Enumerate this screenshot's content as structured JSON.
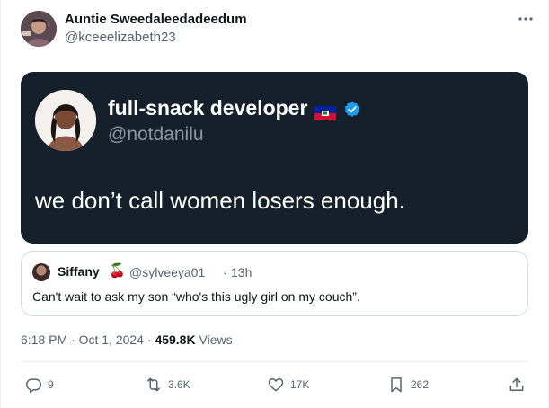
{
  "author": {
    "name": "Auntie Sweedaleedadeedum",
    "handle": "@kceeelizabeth23"
  },
  "menu_icon": "more-horizontal-icon",
  "embedded_post": {
    "name": "full-snack developer",
    "handle": "@notdanilu",
    "text": "we don’t call women losers enough.",
    "flag_icon": "haiti-flag-icon",
    "verified_icon": "verified-badge-icon",
    "background_color": "#15202b"
  },
  "quote": {
    "name": "Siffany",
    "emoji": "🍒",
    "handle": "@sylveeya01",
    "separator": "·",
    "time": "13h",
    "text": "Can't wait to ask my son “who's this ugly girl on my couch”."
  },
  "meta": {
    "time": "6:18 PM",
    "dot1": "·",
    "date": "Oct 1, 2024",
    "dot2": "·",
    "views_count": "459.8K",
    "views_label": "Views"
  },
  "actions": {
    "replies": "9",
    "reposts": "3.6K",
    "likes": "17K",
    "bookmarks": "262"
  },
  "colors": {
    "text_primary": "#0f1419",
    "text_secondary": "#536471",
    "verified_blue": "#1d9bf0",
    "border": "#cfd9de"
  }
}
